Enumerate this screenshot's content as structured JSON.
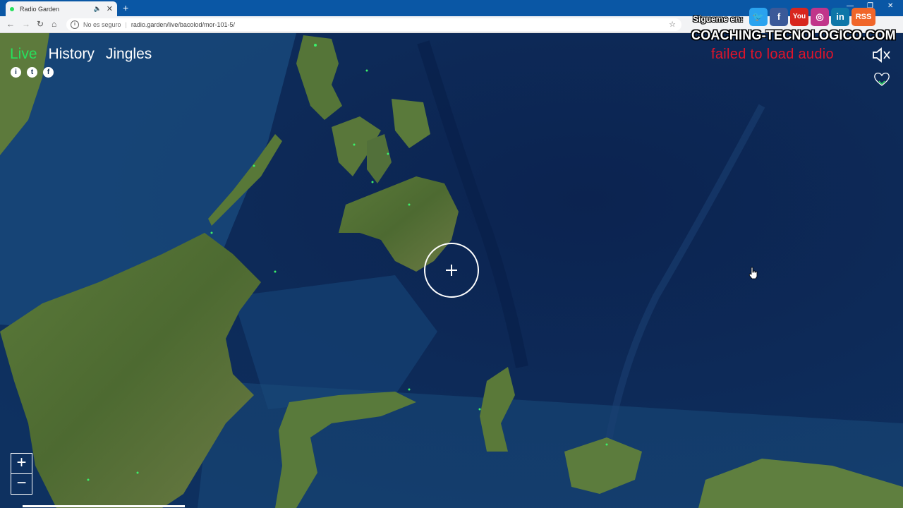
{
  "browser": {
    "tab_title": "Radio Garden",
    "tab_audio_icon": "speaker-icon",
    "new_tab": "+",
    "security_label": "No es seguro",
    "url": "radio.garden/live/bacolod/mor-101-5/"
  },
  "nav": {
    "live": "Live",
    "history": "History",
    "jingles": "Jingles"
  },
  "status": {
    "message": "failed to load audio"
  },
  "zoom": {
    "in": "+",
    "out": "−"
  },
  "watermark": {
    "follow": "Sígueme en:",
    "site": "COACHING-TECNOLOGICO.COM",
    "rss": "RSS",
    "youtube": "You"
  },
  "colors": {
    "accent_live": "#27e05d",
    "error": "#e0142b",
    "tabbar": "#0a57a5",
    "ocean": "#0d2a4f"
  }
}
